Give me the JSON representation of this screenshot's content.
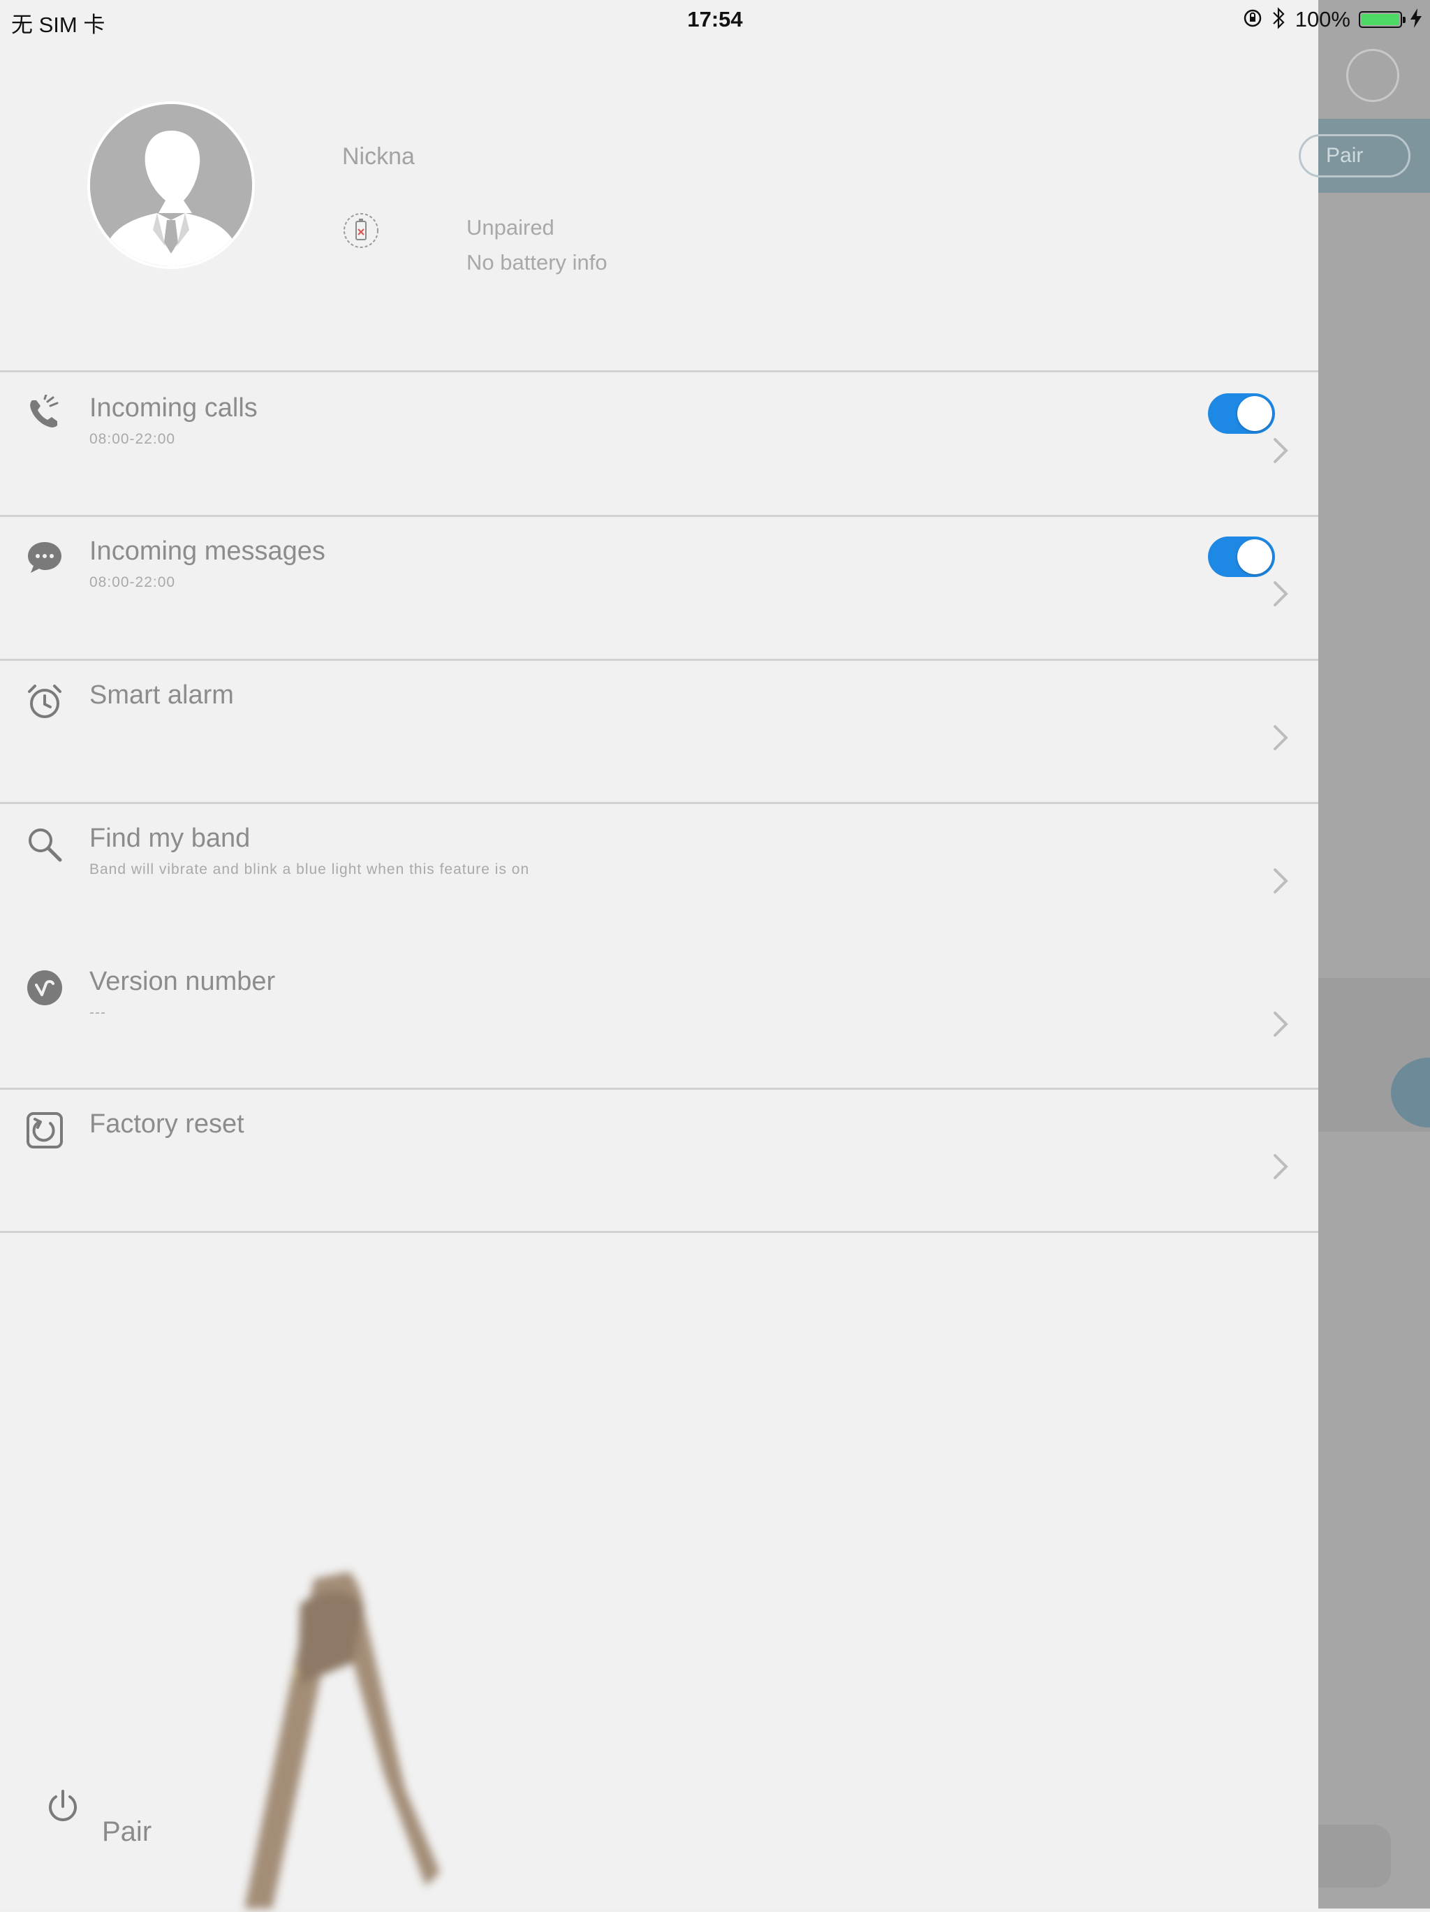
{
  "status_bar": {
    "carrier": "无 SIM 卡",
    "time": "17:54",
    "battery_percent": "100%",
    "battery_color": "#4cd964"
  },
  "profile": {
    "nickname": "Nickna",
    "pair_state": "Unpaired",
    "battery_info": "No battery info"
  },
  "settings": {
    "toggle_color": "#1e88e5",
    "rows": [
      {
        "title": "Incoming calls",
        "subtitle": "08:00-22:00",
        "toggle_on": true,
        "icon": "phone-ring-icon"
      },
      {
        "title": "Incoming messages",
        "subtitle": "08:00-22:00",
        "toggle_on": true,
        "icon": "chat-bubble-icon"
      },
      {
        "title": "Smart alarm",
        "icon": "alarm-clock-icon"
      },
      {
        "title": "Find my band",
        "subtitle": "Band will vibrate and blink a blue light when this feature is on",
        "icon": "magnifier-icon"
      },
      {
        "title": "Version number",
        "subtitle": "---",
        "icon": "version-icon"
      },
      {
        "title": "Factory reset",
        "icon": "reset-icon"
      }
    ]
  },
  "footer": {
    "pair_label": "Pair",
    "power_icon": "power-icon"
  },
  "background_screen": {
    "pair_label": "Pair"
  }
}
